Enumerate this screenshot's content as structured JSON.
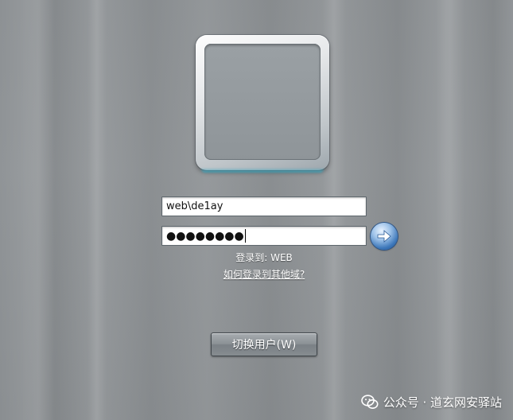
{
  "login": {
    "username_value": "web\\de1ay",
    "password_masked": "●●●●●●●●",
    "domain_line": "登录到: WEB",
    "help_link": "如何登录到其他域?",
    "switch_user_label": "切换用户(W)"
  },
  "watermark": {
    "text": "公众号 · 道玄网安驿站",
    "icon": "wechat-icon"
  },
  "icons": {
    "submit": "arrow-right-icon"
  },
  "colors": {
    "background": "#8d9194",
    "tile_glow": "#3caac3",
    "arrow_button": "#3b76b9"
  }
}
